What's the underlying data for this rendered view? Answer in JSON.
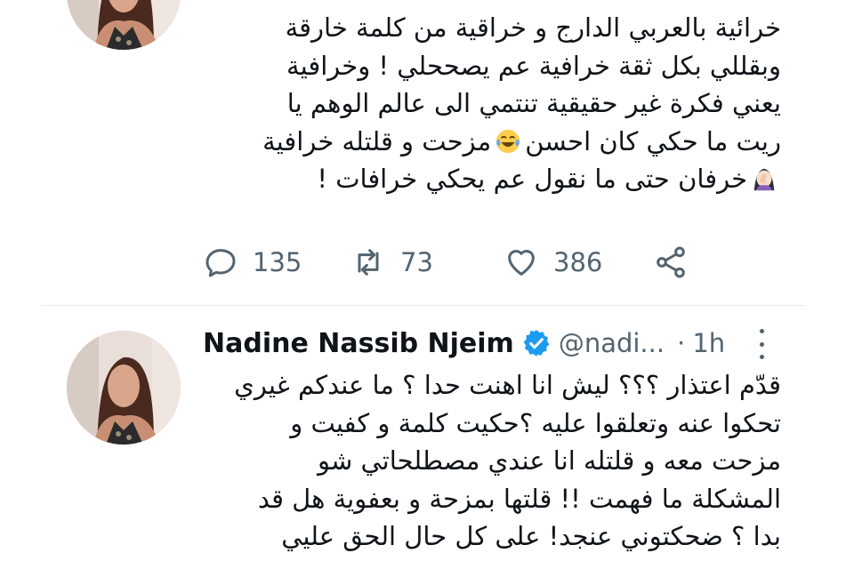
{
  "tweet1": {
    "lines": [
      "خرائية بالعربي الدارج و خراقية من كلمة خارقة",
      "وبقللي بكل ثقة خرافية عم يصححلي ! وخرافية",
      "يعني فكرة غير حقيقية تنتمي الى عالم الوهم يا",
      "ريت ما حكي كان احسن",
      "مزحت و قلتله خرافية",
      "خرفان حتى ما نقول عم يحكي خرافات !"
    ],
    "reply_count": "135",
    "retweet_count": "73",
    "like_count": "386",
    "icons": {
      "reply": "reply-icon",
      "retweet": "retweet-icon",
      "like": "heart-icon",
      "share": "share-icon",
      "laugh_emoji": "laughing-tears-emoji",
      "facepalm_emoji": "woman-facepalming-emoji"
    }
  },
  "tweet2": {
    "name": "Nadine Nassib Njeim",
    "handle": "@nadi...",
    "separator": "·",
    "time": "1h",
    "lines": [
      "قدّم اعتذار ؟؟؟ ليش انا اهنت حدا ؟ ما عندكم غيري",
      "تحكوا عنه وتعلقوا عليه ؟حكيت كلمة و كفيت و",
      "مزحت معه و قلتله انا عندي مصطلحاتي شو",
      "المشكلة ما فهمت !! قلتها بمزحة و بعفوية هل قد",
      "بدا ؟ ضحكتوني عنجد! على كل حال الحق عليي"
    ]
  },
  "colors": {
    "text": "#0f1419",
    "secondary": "#536471",
    "verified": "#1d9bf0",
    "divider": "#e6ecf0"
  }
}
